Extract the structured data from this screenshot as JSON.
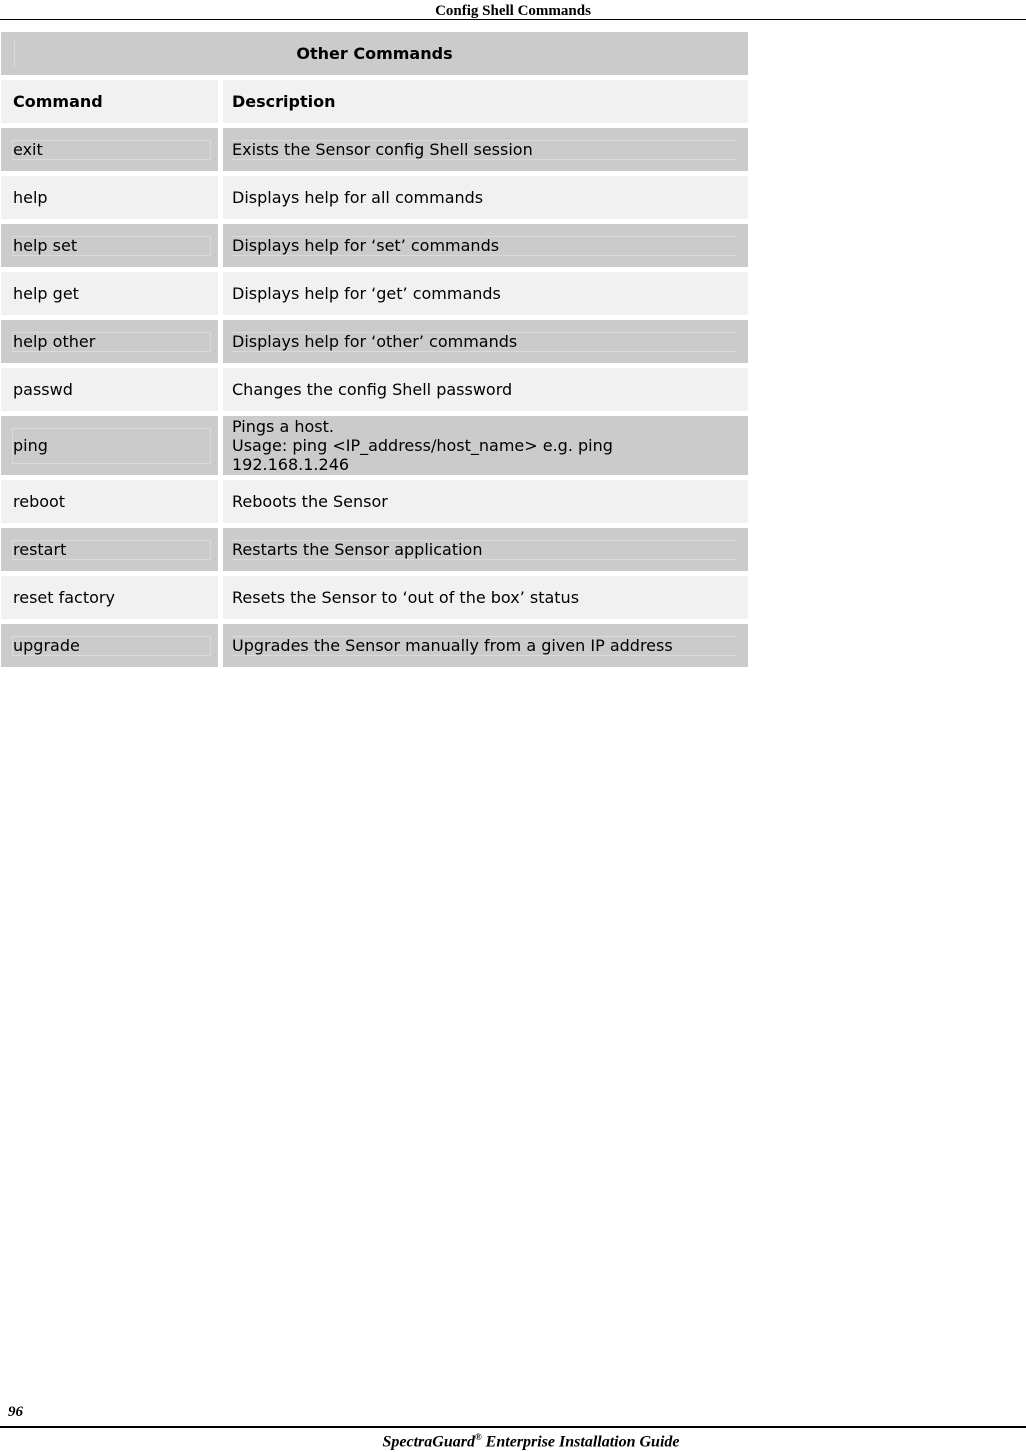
{
  "header": {
    "section_title": "Config Shell Commands"
  },
  "table": {
    "title": "Other Commands",
    "columns": [
      "Command",
      "Description"
    ],
    "rows": [
      {
        "command": "exit",
        "description": [
          "Exists the Sensor config Shell session"
        ]
      },
      {
        "command": "help",
        "description": [
          "Displays help for all commands"
        ]
      },
      {
        "command": "help set",
        "description": [
          "Displays help for ‘set’ commands"
        ]
      },
      {
        "command": "help get",
        "description": [
          "Displays help for ‘get’ commands"
        ]
      },
      {
        "command": "help other",
        "description": [
          "Displays help for ‘other’ commands"
        ]
      },
      {
        "command": "passwd",
        "description": [
          "Changes the config Shell password"
        ]
      },
      {
        "command": "ping",
        "description": [
          "Pings a host.",
          "Usage: ping <IP_address/host_name> e.g. ping",
          "192.168.1.246"
        ]
      },
      {
        "command": "reboot",
        "description": [
          "Reboots the Sensor"
        ]
      },
      {
        "command": "restart",
        "description": [
          "Restarts the Sensor application"
        ]
      },
      {
        "command": "reset factory",
        "description": [
          "Resets the Sensor to ‘out of the box’ status"
        ]
      },
      {
        "command": "upgrade",
        "description": [
          "Upgrades the Sensor manually from a given IP address"
        ]
      }
    ]
  },
  "footer": {
    "page_number": "96",
    "guide_title": "SpectraGuard",
    "guide_trademark": "®",
    "guide_subtitle": " Enterprise Installation Guide"
  },
  "colors": {
    "row_dark": "#cbcbcb",
    "row_light": "#f1f1f1"
  }
}
